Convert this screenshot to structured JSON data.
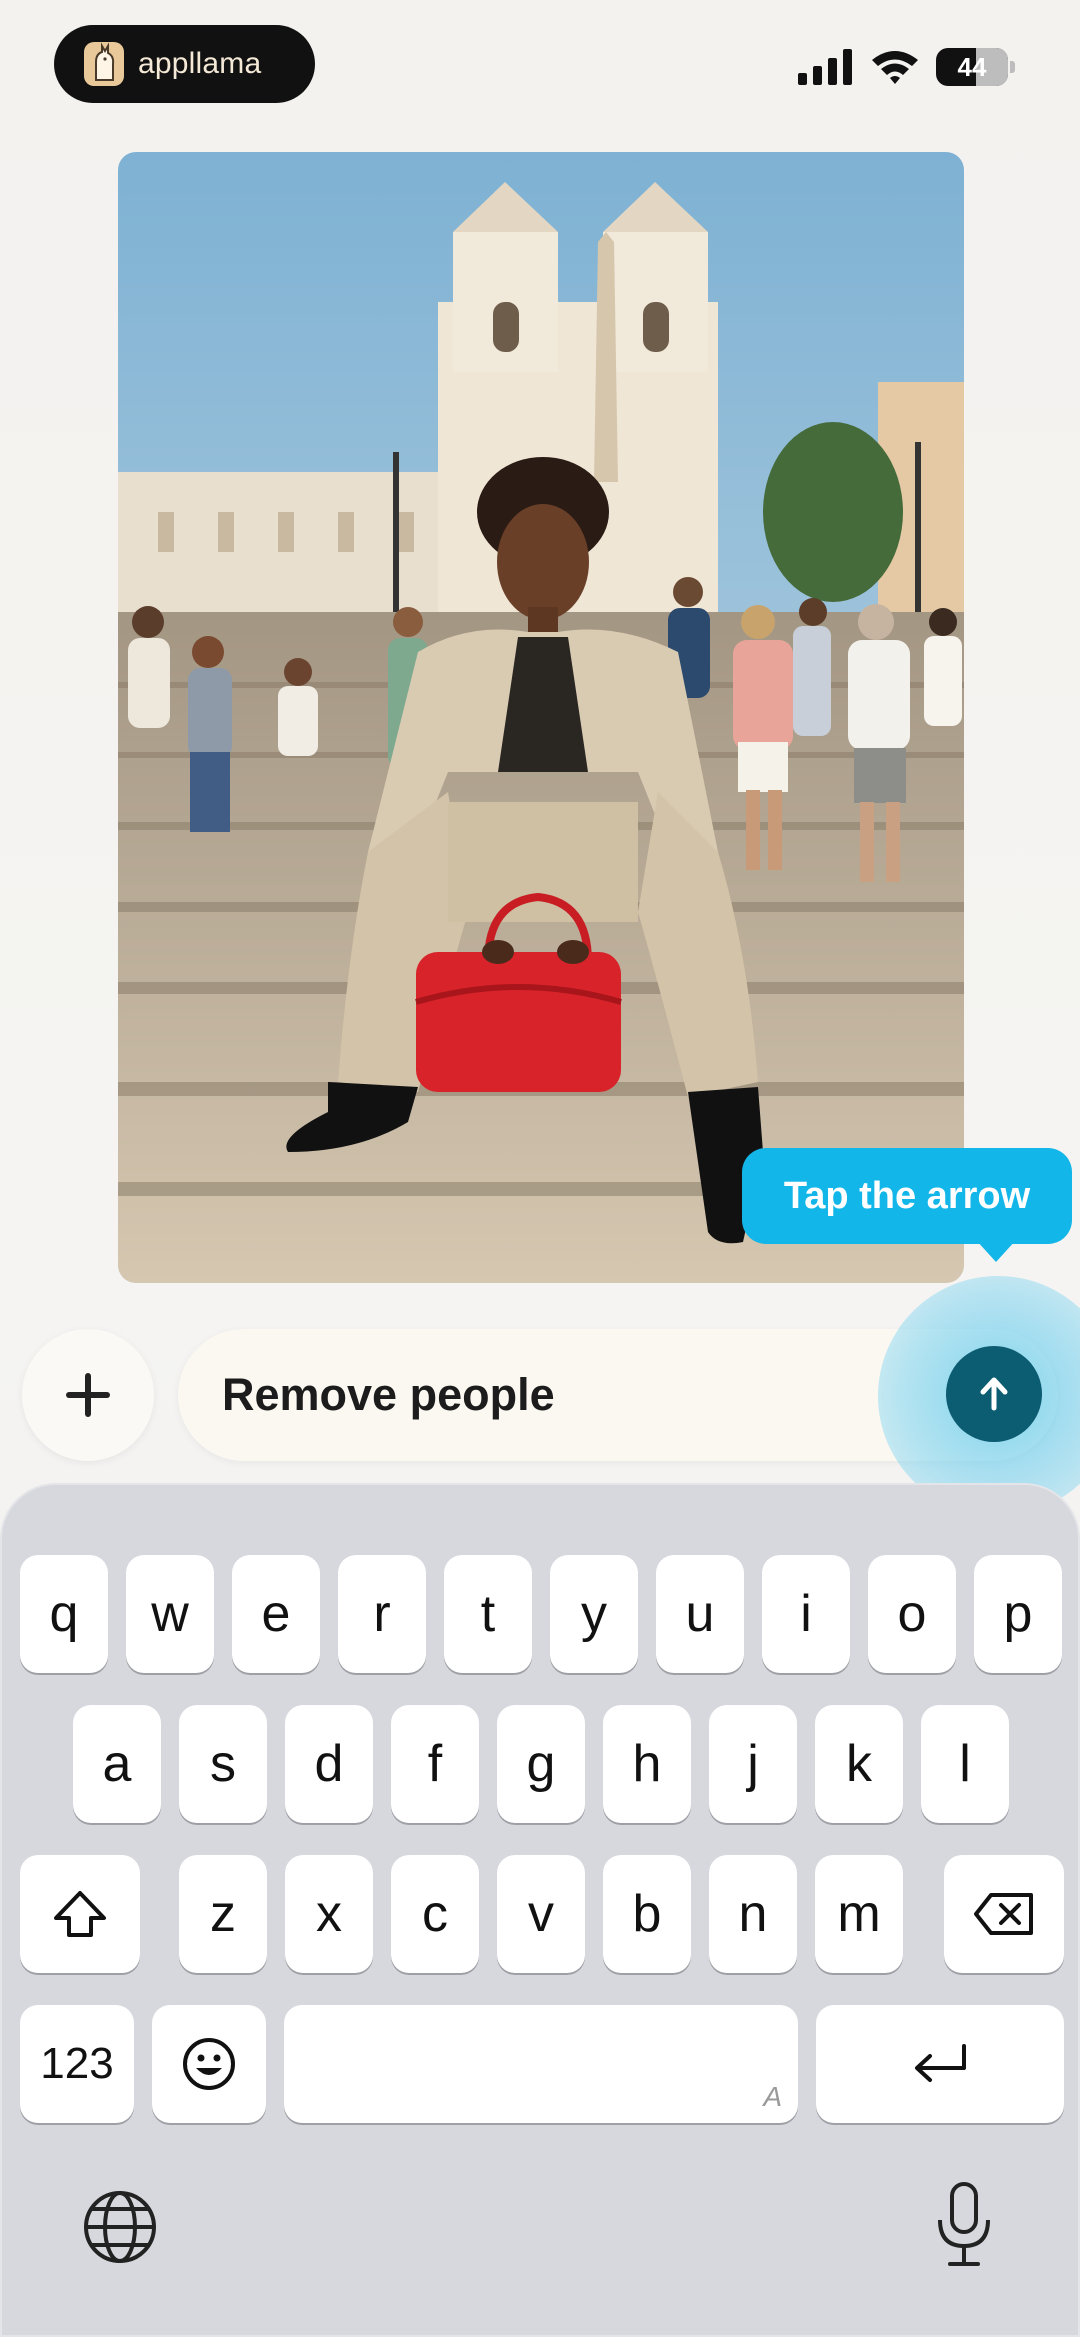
{
  "status_bar": {
    "app_name": "appllama",
    "battery_level": "44",
    "icons": [
      "signal-icon",
      "wifi-icon",
      "battery-icon"
    ]
  },
  "photo": {
    "description_icon": "generated-photo"
  },
  "tooltip": {
    "text": "Tap the arrow",
    "color": "#12b6e8"
  },
  "composer": {
    "prompt_value": "Remove people",
    "add_icon": "plus-icon",
    "send_icon": "arrow-up-icon",
    "send_color": "#0d5d72"
  },
  "keyboard": {
    "row1": [
      "q",
      "w",
      "e",
      "r",
      "t",
      "y",
      "u",
      "i",
      "o",
      "p"
    ],
    "row2": [
      "a",
      "s",
      "d",
      "f",
      "g",
      "h",
      "j",
      "k",
      "l"
    ],
    "row3": [
      "z",
      "x",
      "c",
      "v",
      "b",
      "n",
      "m"
    ],
    "numbers_label": "123",
    "space_hint": "A",
    "bottom_icons": [
      "globe-icon",
      "microphone-icon"
    ]
  }
}
